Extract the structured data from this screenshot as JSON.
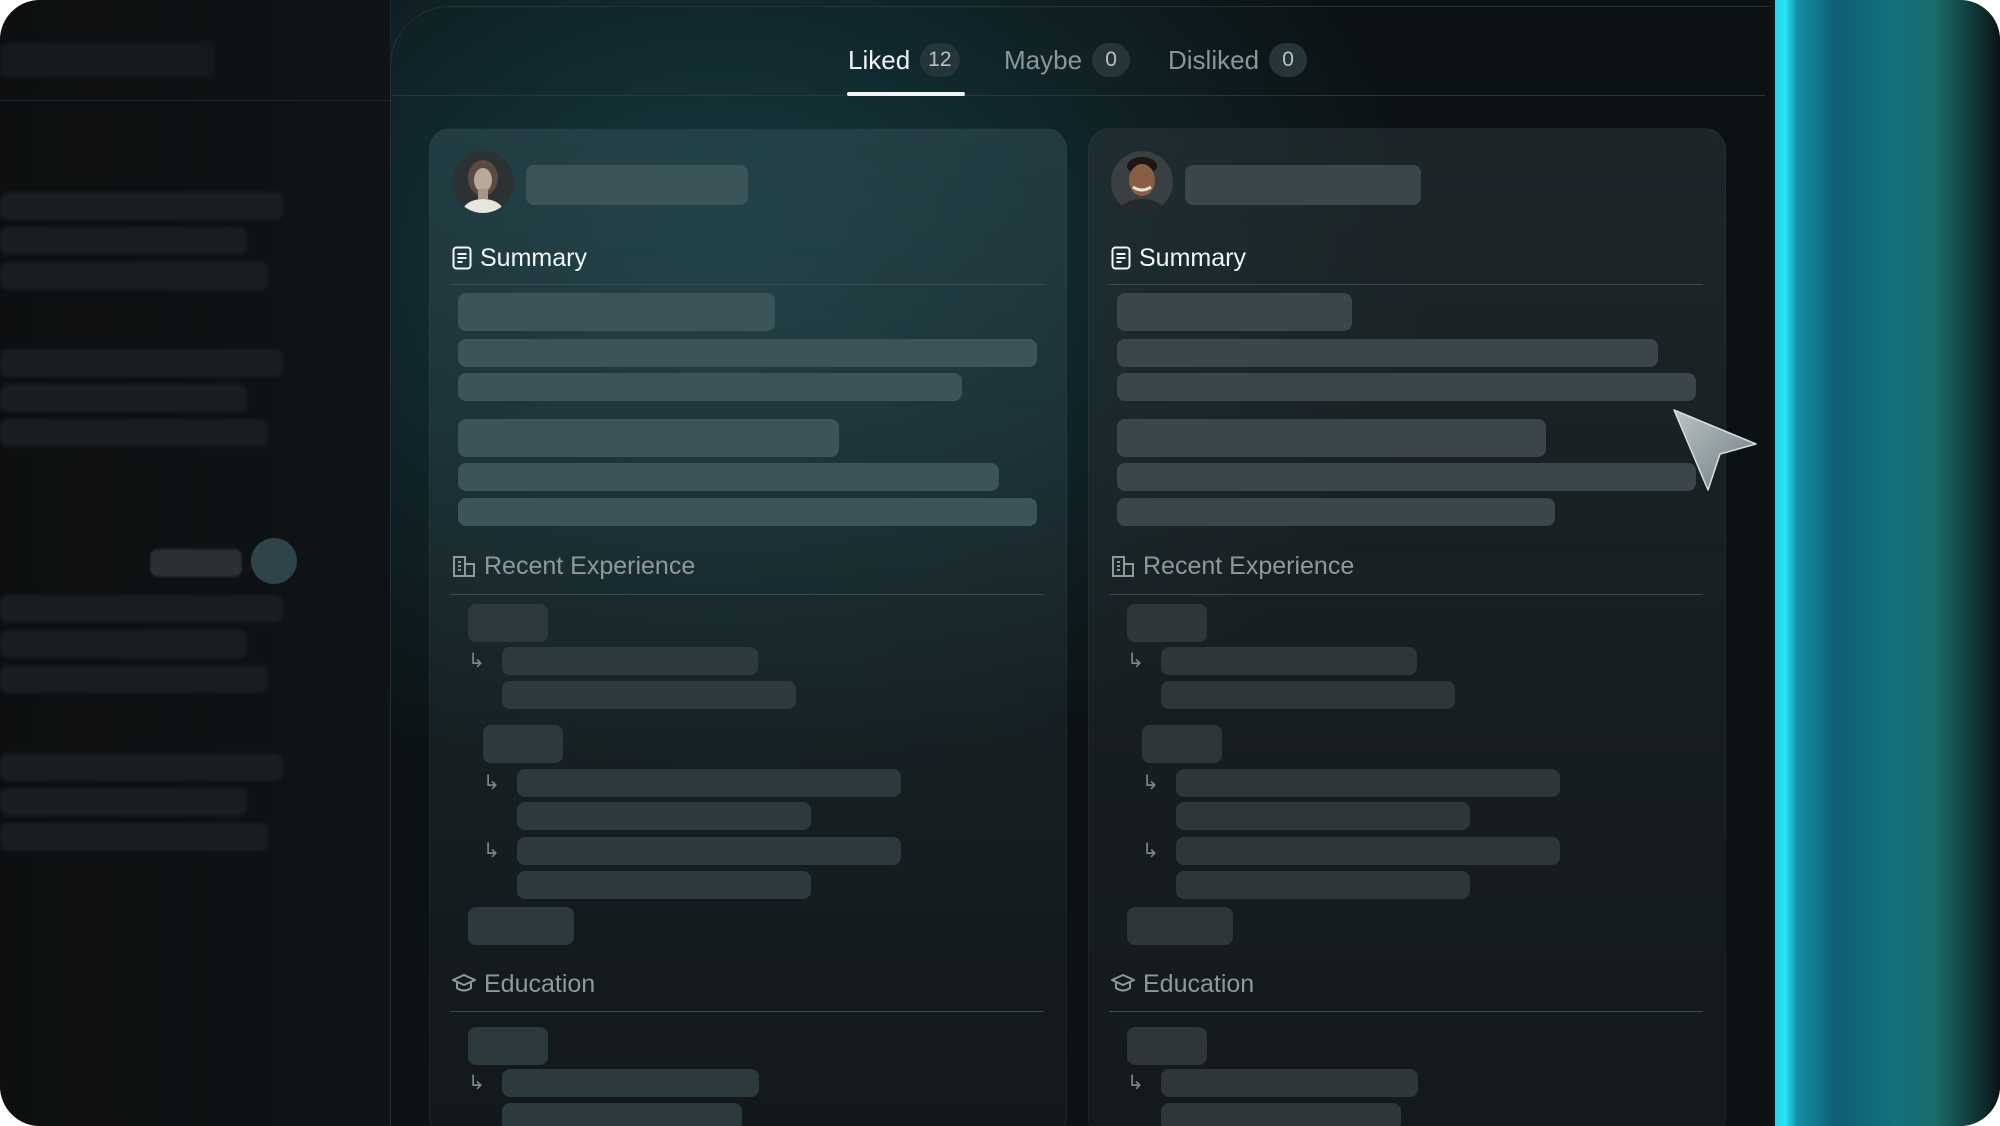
{
  "tabs": [
    {
      "label": "Liked",
      "count": "12",
      "active": true
    },
    {
      "label": "Maybe",
      "count": "0",
      "active": false
    },
    {
      "label": "Disliked",
      "count": "0",
      "active": false
    }
  ],
  "cards": [
    {
      "sections": {
        "summary": "Summary",
        "experience": "Recent Experience",
        "education": "Education"
      }
    },
    {
      "sections": {
        "summary": "Summary",
        "experience": "Recent Experience",
        "education": "Education"
      }
    }
  ],
  "icons": {
    "summary": "document-icon",
    "experience": "building-icon",
    "education": "graduation-cap-icon",
    "sub_item": "return-arrow-icon",
    "pointer": "cursor-pointer-icon"
  },
  "colors": {
    "accent_glow": "#2be4f7",
    "background": "#0c1113",
    "active_tab": "#f2f5f5",
    "muted_text": "#8e999c"
  }
}
